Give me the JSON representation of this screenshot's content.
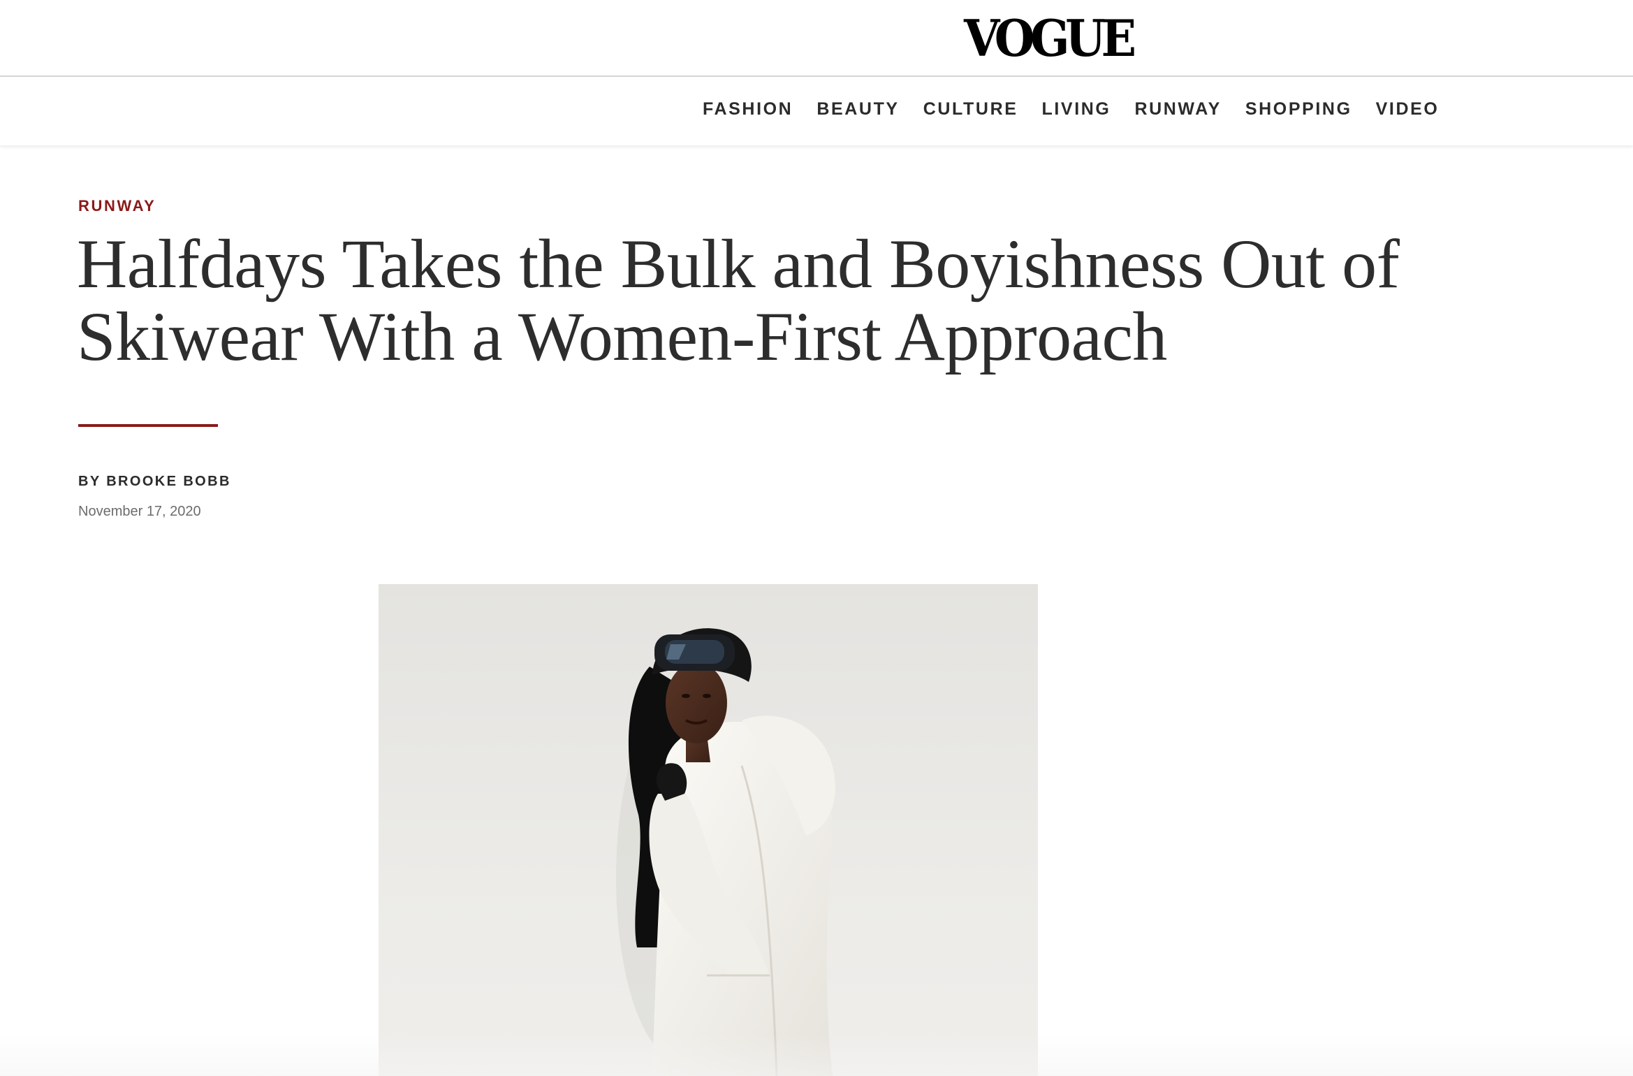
{
  "site": {
    "logo_text": "VOGUE"
  },
  "nav": {
    "items": [
      {
        "label": "FASHION"
      },
      {
        "label": "BEAUTY"
      },
      {
        "label": "CULTURE"
      },
      {
        "label": "LIVING"
      },
      {
        "label": "RUNWAY"
      },
      {
        "label": "SHOPPING"
      },
      {
        "label": "VIDEO"
      }
    ]
  },
  "article": {
    "kicker": "RUNWAY",
    "headline": "Halfdays Takes the Bulk and Boyishness Out of Skiwear With a Women-First Approach",
    "byline_prefix": "BY",
    "author": "BROOKE BOBB",
    "date": "November 17, 2020"
  },
  "colors": {
    "accent": "#8b1a1a",
    "text": "#2d2d2d",
    "muted": "#6c6c6c"
  },
  "lead_image": {
    "subject": "woman-in-white-ski-jacket-with-goggles"
  }
}
